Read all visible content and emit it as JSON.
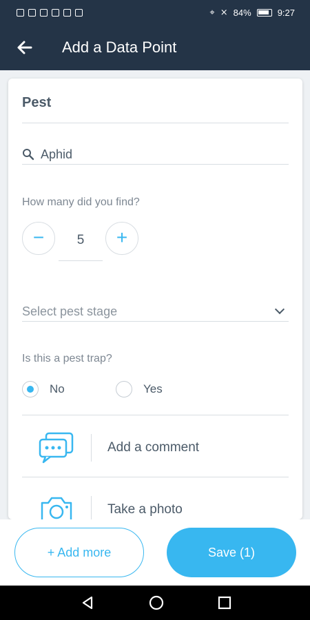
{
  "status_bar": {
    "battery": "84%",
    "time": "9:27"
  },
  "app_bar": {
    "title": "Add a Data Point"
  },
  "pest": {
    "section_title": "Pest",
    "search_value": "Aphid"
  },
  "count": {
    "question": "How many did you find?",
    "value": "5",
    "minus": "−",
    "plus": "+"
  },
  "stage": {
    "placeholder": "Select pest stage"
  },
  "trap": {
    "question": "Is this a pest trap?",
    "options": [
      {
        "label": "No",
        "selected": true
      },
      {
        "label": "Yes",
        "selected": false
      }
    ]
  },
  "actions": {
    "comment": "Add a comment",
    "photo": "Take a photo"
  },
  "buttons": {
    "add_more": "+ Add more",
    "save": "Save (1)"
  },
  "colors": {
    "header": "#243447",
    "accent": "#38B7F0"
  },
  "icons": [
    "back-arrow-icon",
    "search-icon",
    "minus-icon",
    "plus-icon",
    "chevron-down-icon",
    "comment-icon",
    "camera-icon",
    "back-triangle-icon",
    "home-circle-icon",
    "recent-square-icon"
  ]
}
